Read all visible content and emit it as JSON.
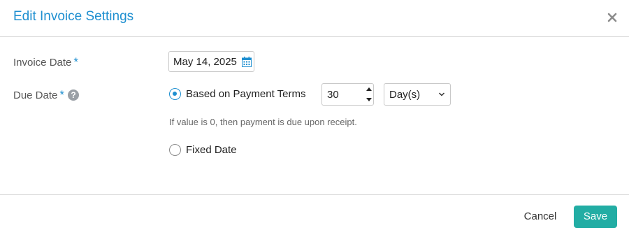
{
  "dialog": {
    "title": "Edit Invoice Settings",
    "close_icon": "close-icon"
  },
  "invoice_date": {
    "label": "Invoice Date",
    "required_mark": "*",
    "value": "May 14, 2025",
    "icon": "calendar-icon"
  },
  "due_date": {
    "label": "Due Date",
    "required_mark": "*",
    "help_icon": "question-circle-icon",
    "help_glyph": "?",
    "payment_terms": {
      "label": "Based on Payment Terms",
      "selected": true,
      "value": "30",
      "unit_selected": "Day(s)",
      "hint": "If value is 0, then payment is due upon receipt."
    },
    "fixed_date": {
      "label": "Fixed Date",
      "selected": false
    }
  },
  "footer": {
    "cancel_label": "Cancel",
    "save_label": "Save"
  },
  "colors": {
    "accent": "#1e8fd0",
    "save_button": "#22ada4"
  }
}
